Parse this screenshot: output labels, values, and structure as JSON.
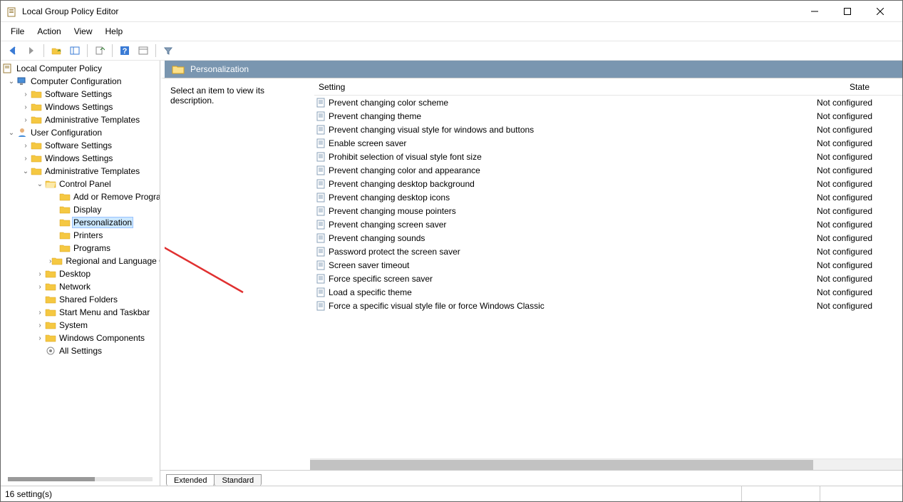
{
  "window": {
    "title": "Local Group Policy Editor"
  },
  "menu": [
    "File",
    "Action",
    "View",
    "Help"
  ],
  "tree": {
    "root": "Local Computer Policy",
    "compConf": "Computer Configuration",
    "userConf": "User Configuration",
    "softwareSettings": "Software Settings",
    "windowsSettings": "Windows Settings",
    "adminTemplates": "Administrative Templates",
    "controlPanel": "Control Panel",
    "cpItems": {
      "addRemove": "Add or Remove Programs",
      "display": "Display",
      "personalization": "Personalization",
      "printers": "Printers",
      "programs": "Programs",
      "regional": "Regional and Language Options"
    },
    "other": {
      "desktop": "Desktop",
      "network": "Network",
      "sharedFolders": "Shared Folders",
      "startMenu": "Start Menu and Taskbar",
      "system": "System",
      "winComponents": "Windows Components",
      "allSettings": "All Settings"
    }
  },
  "header": {
    "title": "Personalization"
  },
  "description": "Select an item to view its description.",
  "columns": {
    "setting": "Setting",
    "state": "State"
  },
  "settings": [
    {
      "name": "Prevent changing color scheme",
      "state": "Not configured"
    },
    {
      "name": "Prevent changing theme",
      "state": "Not configured"
    },
    {
      "name": "Prevent changing visual style for windows and buttons",
      "state": "Not configured"
    },
    {
      "name": "Enable screen saver",
      "state": "Not configured"
    },
    {
      "name": "Prohibit selection of visual style font size",
      "state": "Not configured"
    },
    {
      "name": "Prevent changing color and appearance",
      "state": "Not configured"
    },
    {
      "name": "Prevent changing desktop background",
      "state": "Not configured"
    },
    {
      "name": "Prevent changing desktop icons",
      "state": "Not configured"
    },
    {
      "name": "Prevent changing mouse pointers",
      "state": "Not configured"
    },
    {
      "name": "Prevent changing screen saver",
      "state": "Not configured"
    },
    {
      "name": "Prevent changing sounds",
      "state": "Not configured"
    },
    {
      "name": "Password protect the screen saver",
      "state": "Not configured"
    },
    {
      "name": "Screen saver timeout",
      "state": "Not configured"
    },
    {
      "name": "Force specific screen saver",
      "state": "Not configured"
    },
    {
      "name": "Load a specific theme",
      "state": "Not configured"
    },
    {
      "name": "Force a specific visual style file or force Windows Classic",
      "state": "Not configured"
    }
  ],
  "tabs": {
    "extended": "Extended",
    "standard": "Standard"
  },
  "status": "16 setting(s)"
}
